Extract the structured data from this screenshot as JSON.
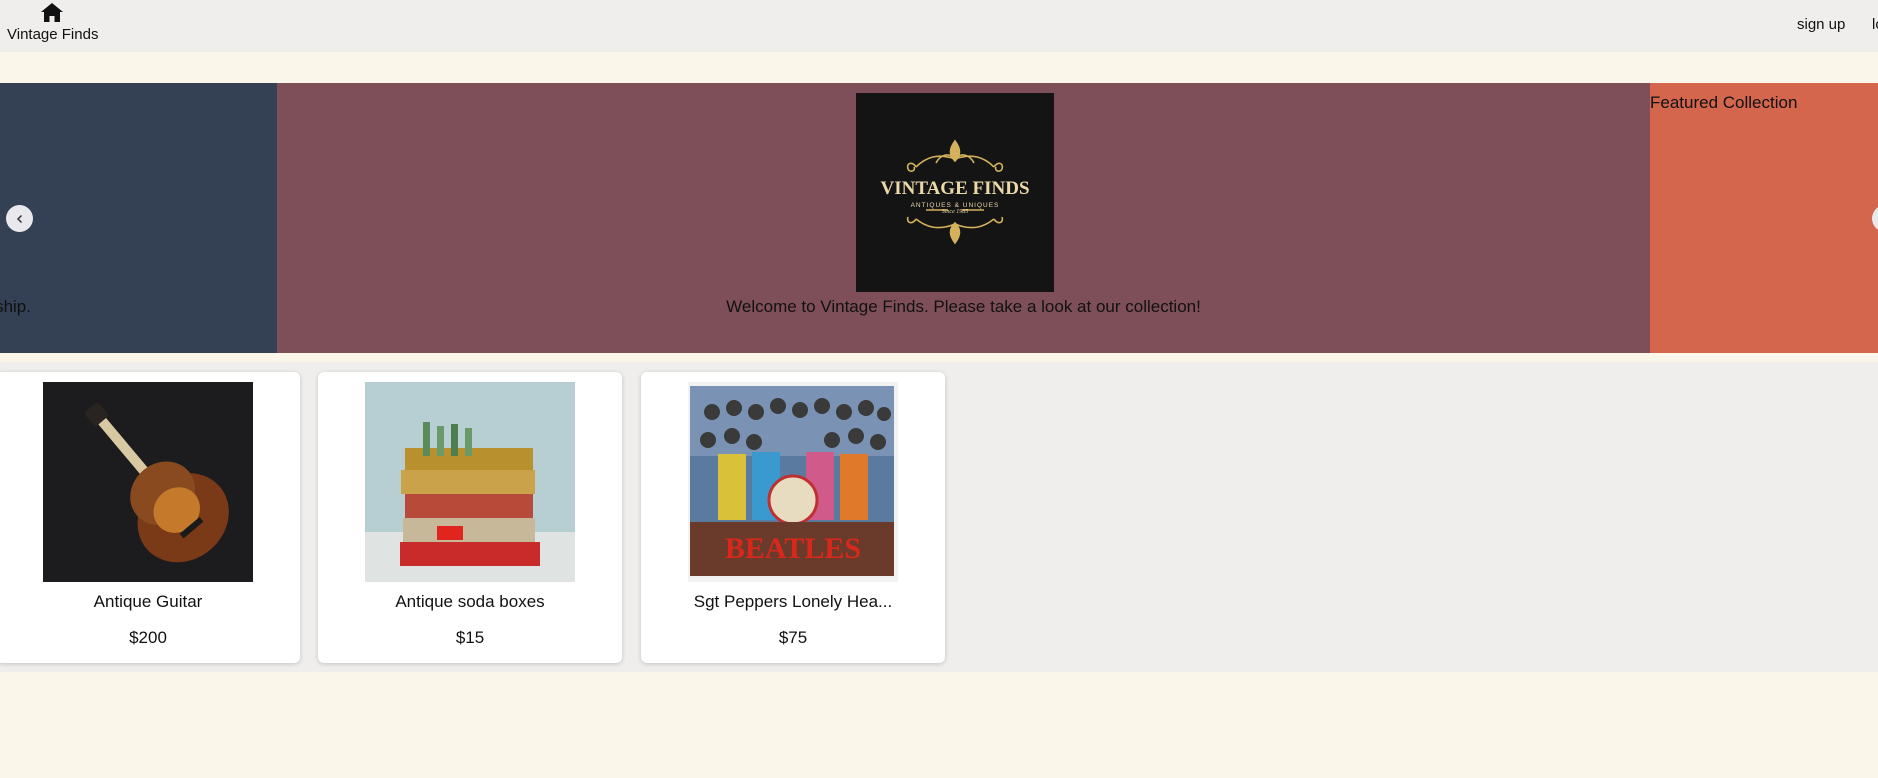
{
  "header": {
    "home_label": "Vintage Finds",
    "home_icon": "home-icon",
    "signup_label": "sign up",
    "login_label": "lo"
  },
  "carousel": {
    "slides": [
      {
        "caption": "ship."
      },
      {
        "logo_title": "VINTAGE FINDS",
        "logo_subtitle": "ANTIQUES & UNIQUES",
        "logo_since": "Since 1985",
        "caption": "Welcome to Vintage Finds. Please take a look at our collection!"
      },
      {
        "caption": "Featured Collection"
      }
    ],
    "prev_icon": "chevron-left-icon",
    "colors": {
      "left": "#344054",
      "center": "#7e4f59",
      "right": "#d4664e"
    }
  },
  "products": [
    {
      "name": "Antique Guitar",
      "price": "$200",
      "image": "guitar-image"
    },
    {
      "name": "Antique soda boxes",
      "price": "$15",
      "image": "soda-crates-image"
    },
    {
      "name": "Sgt Peppers Lonely Hea...",
      "price": "$75",
      "image": "album-cover-image"
    }
  ]
}
